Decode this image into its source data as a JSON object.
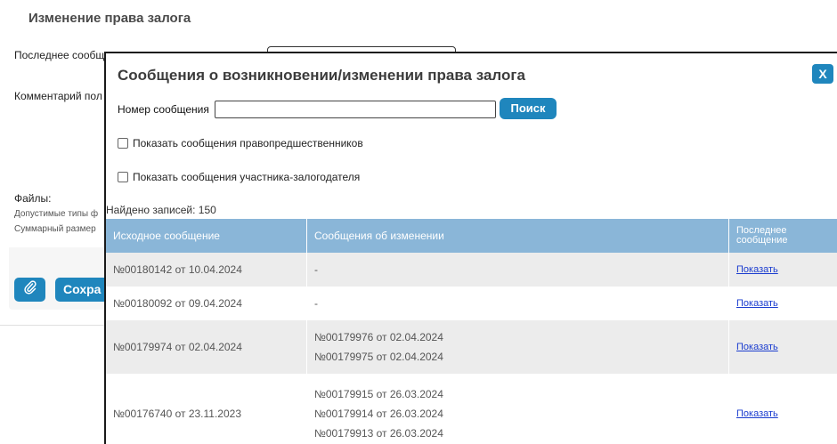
{
  "background": {
    "title": "Изменение права залога",
    "last_message_label": "Последнее сообщ",
    "comment_label": "Комментарий пол",
    "files_label": "Файлы:",
    "allowed_types_label": "Допустимые типы ф",
    "total_size_label": "Суммарный размер",
    "save_button": "Сохра",
    "attach_icon": "paperclip-icon"
  },
  "modal": {
    "title": "Сообщения о возникновении/изменении права залога",
    "close_label": "X",
    "search": {
      "label": "Номер сообщения",
      "value": "",
      "button": "Поиск"
    },
    "checkboxes": [
      {
        "label": "Показать сообщения правопредшественников",
        "checked": false
      },
      {
        "label": "Показать сообщения участника-залогодателя",
        "checked": false
      }
    ],
    "found_text": "Найдено записей: 150",
    "table": {
      "headers": [
        "Исходное сообщение",
        "Сообщения об изменении",
        "Последнее сообщение"
      ],
      "rows": [
        {
          "original": "№00180142 от 10.04.2024",
          "changes": [
            "-"
          ],
          "action": "Показать"
        },
        {
          "original": "№00180092 от 09.04.2024",
          "changes": [
            "-"
          ],
          "action": "Показать"
        },
        {
          "original": "№00179974 от 02.04.2024",
          "changes": [
            "№00179976 от 02.04.2024",
            "№00179975 от 02.04.2024"
          ],
          "action": "Показать"
        },
        {
          "original": "№00176740 от 23.11.2023",
          "changes": [
            "№00179915 от 26.03.2024",
            "№00179914 от 26.03.2024",
            "№00179913 от 26.03.2024"
          ],
          "action": "Показать"
        }
      ]
    }
  },
  "colors": {
    "accent": "#1f86bd",
    "table_header": "#8ab6d8",
    "link": "#1a3ccf"
  }
}
